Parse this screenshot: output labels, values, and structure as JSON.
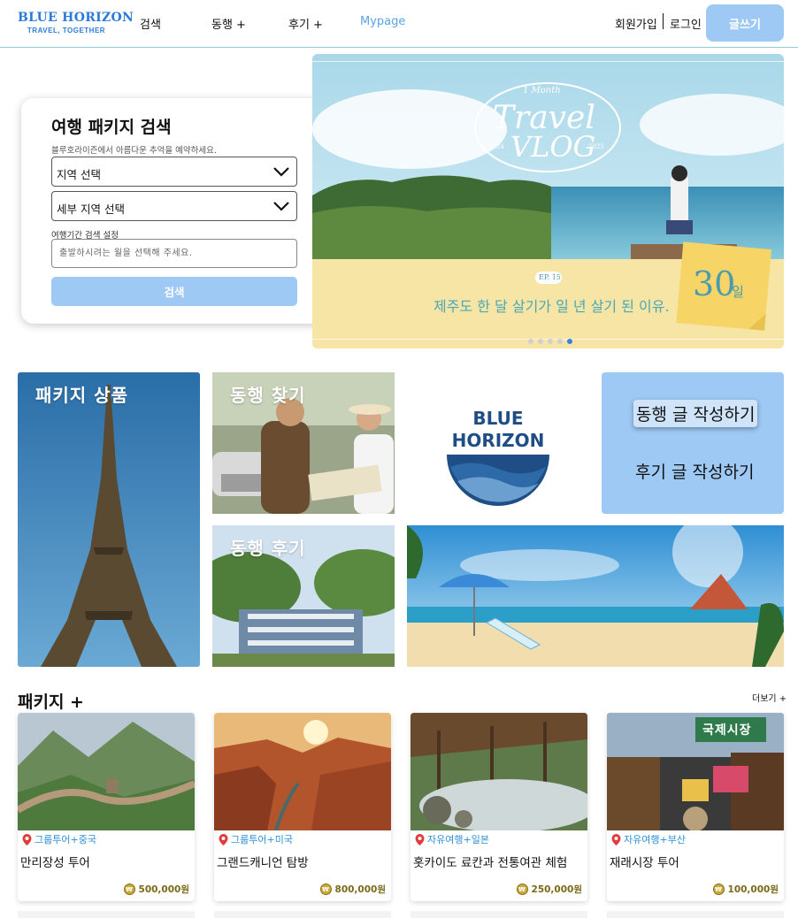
{
  "header": {
    "logo_main": "BLUE HORIZON",
    "logo_sub": "TRAVEL, TOGETHER",
    "nav": [
      {
        "label": "검색"
      },
      {
        "label": "동행 +"
      },
      {
        "label": "후기 +"
      },
      {
        "label": "Mypage",
        "active": true
      }
    ],
    "signup": "회원가입",
    "login": "로그인",
    "write_button": "글쓰기"
  },
  "search": {
    "title": "여행 패키지 검색",
    "description": "블루호라이즌에서 아름다운 추억을 예약하세요.",
    "region_select": "지역 선택",
    "subregion_select": "세부 지역 선택",
    "period_label": "여행기간 검색 설정",
    "period_placeholder": "출발하시려는 월을 선택해 주세요.",
    "button": "검색"
  },
  "banner": {
    "top_small": "1 Month",
    "title_line1": "Travel",
    "title_line2": "VLOG",
    "year_left": "2024",
    "year_right": "2025",
    "episode": "EP. 15",
    "caption": "제주도 한 달 살기가 일 년 살기 된 이유.",
    "note_number": "30",
    "note_unit": "일",
    "slide_count": 5,
    "active_slide": 5
  },
  "tiles": {
    "package": "패키지 상품",
    "find_companion": "동행 찾기",
    "companion_review": "동행 후기",
    "brand_line1": "BLUE",
    "brand_line2": "HORIZON",
    "write_companion": "동행 글 작성하기",
    "write_review": "후기 글 작성하기"
  },
  "packages": {
    "title": "패키지 +",
    "more": "더보기 +",
    "items": [
      {
        "tag": "그룹투어+중국",
        "name": "만리장성 투어",
        "price": "500,000원"
      },
      {
        "tag": "그룹투어+미국",
        "name": "그랜드캐니언 탐방",
        "price": "800,000원"
      },
      {
        "tag": "자유여행+일본",
        "name": "홋카이도 료칸과 전통여관 체험",
        "price": "250,000원"
      },
      {
        "tag": "자유여행+부산",
        "name": "재래시장 투어",
        "price": "100,000원"
      }
    ]
  },
  "market_sign": "국제시장",
  "colors": {
    "accent": "#9ec9f5",
    "brand": "#2c7bd8",
    "tag_text": "#2d8fd8",
    "header_border": "#8fd0dc"
  },
  "icons": [
    "chevron-down-icon",
    "location-pin-icon",
    "won-coin-icon"
  ]
}
